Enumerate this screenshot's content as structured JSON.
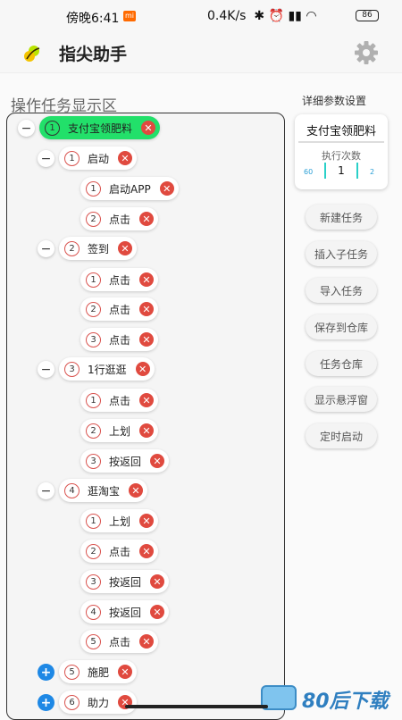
{
  "status_bar": {
    "time": "傍晚6:41",
    "network_speed": "0.4K/s",
    "battery": "86"
  },
  "app": {
    "title": "指尖助手"
  },
  "tree": {
    "section_title": "操作任务显示区",
    "nodes": [
      {
        "index": "1",
        "label": "支付宝领肥料",
        "highlighted": true,
        "toggle": "−"
      },
      {
        "index": "1",
        "label": "启动",
        "toggle": "−"
      },
      {
        "index": "1",
        "label": "启动APP"
      },
      {
        "index": "2",
        "label": "点击"
      },
      {
        "index": "2",
        "label": "签到",
        "toggle": "−"
      },
      {
        "index": "1",
        "label": "点击"
      },
      {
        "index": "2",
        "label": "点击"
      },
      {
        "index": "3",
        "label": "点击"
      },
      {
        "index": "3",
        "label": "1行逛逛",
        "toggle": "−"
      },
      {
        "index": "1",
        "label": "点击"
      },
      {
        "index": "2",
        "label": "上划"
      },
      {
        "index": "3",
        "label": "按返回"
      },
      {
        "index": "4",
        "label": "逛淘宝",
        "toggle": "−"
      },
      {
        "index": "1",
        "label": "上划"
      },
      {
        "index": "2",
        "label": "点击"
      },
      {
        "index": "3",
        "label": "按返回"
      },
      {
        "index": "4",
        "label": "按返回"
      },
      {
        "index": "5",
        "label": "点击"
      },
      {
        "index": "5",
        "label": "施肥",
        "toggle": "+"
      },
      {
        "index": "6",
        "label": "助力",
        "toggle": "+"
      }
    ]
  },
  "params": {
    "section_title": "详细参数设置",
    "task_name": "支付宝领肥料",
    "exec_label": "执行次数",
    "min": "60",
    "value": "1",
    "max": "2"
  },
  "side_buttons": [
    "新建任务",
    "插入子任务",
    "导入任务",
    "保存到仓库",
    "任务仓库",
    "显示悬浮窗",
    "定时启动"
  ],
  "watermark": {
    "text": "80后下载"
  },
  "colors": {
    "highlight_green": "#22e06a",
    "delete_red": "#e04a3f",
    "expand_blue": "#1e88e5"
  }
}
